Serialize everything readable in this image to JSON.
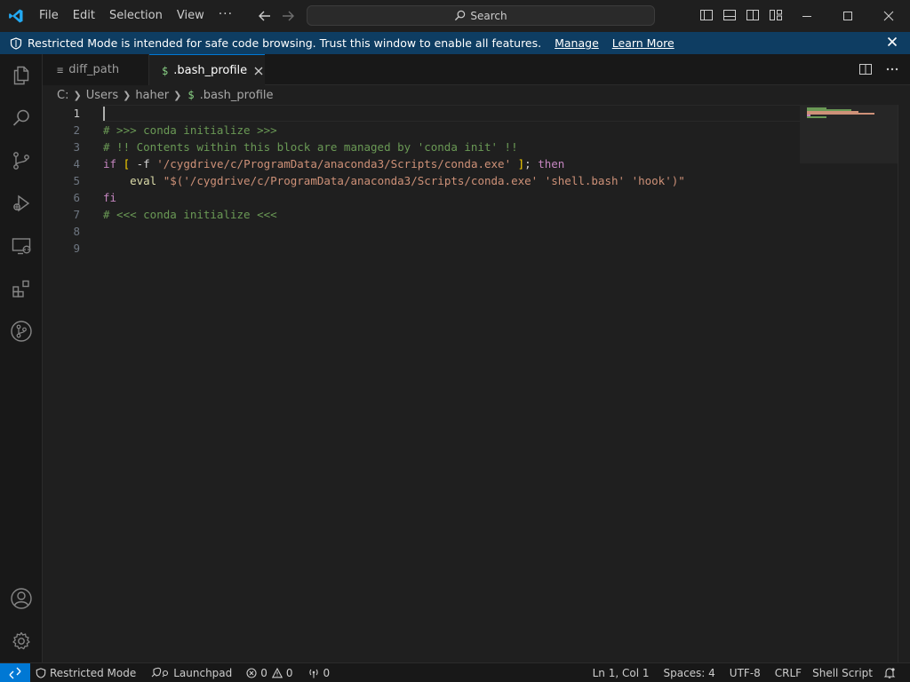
{
  "titlebar": {
    "menu": [
      "File",
      "Edit",
      "Selection",
      "View"
    ],
    "more": "···",
    "search_label": "Search"
  },
  "banner": {
    "message": "Restricted Mode is intended for safe code browsing. Trust this window to enable all features.",
    "manage": "Manage",
    "learn_more": "Learn More"
  },
  "tabs": [
    {
      "label": "diff_path",
      "icon": "≡",
      "active": false
    },
    {
      "label": ".bash_profile",
      "icon": "$",
      "active": true
    }
  ],
  "breadcrumb": [
    "C:",
    "Users",
    "haher",
    ".bash_profile"
  ],
  "breadcrumb_file_icon": "$",
  "editor": {
    "line_numbers": [
      "1",
      "2",
      "3",
      "4",
      "5",
      "6",
      "7",
      "8",
      "9"
    ],
    "active_line": "1",
    "lines": {
      "l2": "# >>> conda initialize >>>",
      "l3": "# !! Contents within this block are managed by 'conda init' !!",
      "l4_if": "if",
      "l4_open": "[",
      "l4_flag": " -f ",
      "l4_str": "'/cygdrive/c/ProgramData/anaconda3/Scripts/conda.exe'",
      "l4_close": "]",
      "l4_semi": "; ",
      "l4_then": "then",
      "l5_indent": "    ",
      "l5_eval": "eval",
      "l5_space": " ",
      "l5_str1": "\"$('/cygdrive/c/ProgramData/anaconda3/Scripts/conda.exe'",
      "l5_str2": "'shell.bash'",
      "l5_str3": "'hook')\"",
      "l6": "fi",
      "l7": "# <<< conda initialize <<<"
    }
  },
  "statusbar": {
    "restricted": "Restricted Mode",
    "launchpad": "Launchpad",
    "errors": "0",
    "warnings": "0",
    "ports": "0",
    "position": "Ln 1, Col 1",
    "spaces": "Spaces: 4",
    "encoding": "UTF-8",
    "eol": "CRLF",
    "language": "Shell Script"
  },
  "colors": {
    "accent": "#0078d4",
    "banner_bg": "#0e3d62",
    "comment": "#6a9955",
    "keyword": "#c586c0",
    "string": "#ce9178"
  }
}
